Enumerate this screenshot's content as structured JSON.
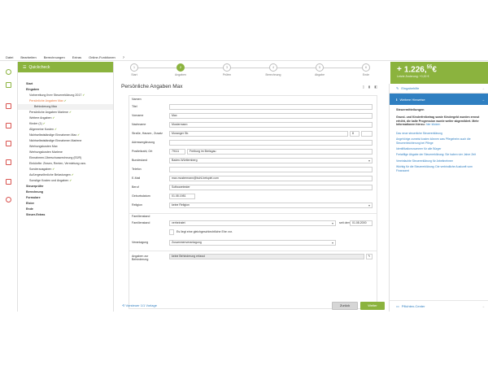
{
  "menu": [
    "Datei",
    "Bearbeiten",
    "Berechnungen",
    "Extras",
    "Online-Funktionen",
    "?"
  ],
  "steps": [
    {
      "num": "1",
      "label": "Start"
    },
    {
      "num": "2",
      "label": "Angaben"
    },
    {
      "num": "3",
      "label": "Prüfen"
    },
    {
      "num": "4",
      "label": "Berechnung"
    },
    {
      "num": "5",
      "label": "Abgabe"
    },
    {
      "num": "6",
      "label": "Ende"
    }
  ],
  "tax": {
    "amount": "1.226,",
    "cents": "55",
    "currency": "€",
    "sub": "Letzte Änderung: +0,00 €"
  },
  "sidebar": {
    "title": "Quickcheck",
    "items": [
      {
        "label": "Start",
        "level": "l1",
        "bold": true,
        "state": "",
        "check": ""
      },
      {
        "label": "Eingaben",
        "level": "l1",
        "bold": true,
        "state": "",
        "check": ""
      },
      {
        "label": "Vorbereitung Ihrer Steuererklärung 2017",
        "level": "l2",
        "bold": false,
        "state": "",
        "check": "✔"
      },
      {
        "label": "Persönliche Angaben Max",
        "level": "l2",
        "bold": false,
        "state": "sel",
        "check": "✔"
      },
      {
        "label": "Behinderung Max",
        "level": "l3",
        "bold": false,
        "state": "sel2",
        "check": ""
      },
      {
        "label": "Persönliche Angaben Marlene",
        "level": "l2",
        "bold": false,
        "state": "",
        "check": "✔"
      },
      {
        "label": "Weitere Angaben",
        "level": "l2",
        "bold": false,
        "state": "",
        "check": "✔"
      },
      {
        "label": "Kinder (1)",
        "level": "l2",
        "bold": false,
        "state": "",
        "check": "✔"
      },
      {
        "label": "Allgemeine Kosten",
        "level": "l2",
        "bold": false,
        "state": "",
        "check": "✔"
      },
      {
        "label": "Nichtselbstständige Einnahmen Max",
        "level": "l2",
        "bold": false,
        "state": "",
        "check": "✔"
      },
      {
        "label": "Nichtselbstständige Einnahmen Marlene",
        "level": "l2",
        "bold": false,
        "state": "",
        "check": ""
      },
      {
        "label": "Werbungskosten Max",
        "level": "l2",
        "bold": false,
        "state": "",
        "check": ""
      },
      {
        "label": "Werbungskosten Marlene",
        "level": "l2",
        "bold": false,
        "state": "",
        "check": ""
      },
      {
        "label": "Einnahmen-Überschussrechnung (EÜR)",
        "level": "l2",
        "bold": false,
        "state": "",
        "check": ""
      },
      {
        "label": "Einkünfte: Zinsen, Renten, Vermietung usw.",
        "level": "l2",
        "bold": false,
        "state": "",
        "check": ""
      },
      {
        "label": "Sonderausgaben",
        "level": "l2",
        "bold": false,
        "state": "",
        "check": "✔"
      },
      {
        "label": "Außergewöhnliche Belastungen",
        "level": "l2",
        "bold": false,
        "state": "",
        "check": "✔"
      },
      {
        "label": "Sonstige Kosten und Angaben",
        "level": "l2",
        "bold": false,
        "state": "",
        "check": "✔"
      },
      {
        "label": "Steuerprüfer",
        "level": "l1",
        "bold": true,
        "state": "",
        "check": ""
      },
      {
        "label": "Berechnung",
        "level": "l1",
        "bold": true,
        "state": "",
        "check": ""
      },
      {
        "label": "Formulare",
        "level": "l1",
        "bold": true,
        "state": "",
        "check": ""
      },
      {
        "label": "Elster",
        "level": "l1",
        "bold": true,
        "state": "",
        "check": ""
      },
      {
        "label": "Ende",
        "level": "l1",
        "bold": true,
        "state": "",
        "check": ""
      },
      {
        "label": "Steuer-Extras",
        "level": "l1",
        "bold": true,
        "state": "",
        "check": ""
      }
    ]
  },
  "main": {
    "title": "Persönliche Angaben Max",
    "tools": "▯ ▮ ◧",
    "section_names": "Namen",
    "fields": {
      "titel": {
        "label": "Titel",
        "value": ""
      },
      "vorname": {
        "label": "Vorname",
        "value": "Max"
      },
      "nachname": {
        "label": "Nachname",
        "value": "Mustermann"
      },
      "strasse": {
        "label": "Straße, Hausnr., Zusatz",
        "value": "Muranger Str.",
        "nr": "8"
      },
      "adresszusatz": {
        "label": "Adressergänzung",
        "value": ""
      },
      "plz": {
        "label": "Postleitzahl, Ort",
        "value": "79111",
        "ort": "Freiburg im Breisgau"
      },
      "bundesland": {
        "label": "Bundesland",
        "value": "Baden-Württemberg"
      },
      "telefon": {
        "label": "Telefon",
        "value": ""
      },
      "email": {
        "label": "E-Mail",
        "value": "max.mustermann@buhl-beispiel.com"
      },
      "beruf": {
        "label": "Beruf",
        "value": "Softwaretester"
      },
      "geburt": {
        "label": "Geburtsdatum",
        "value": "01.08.1981"
      },
      "religion": {
        "label": "Religion",
        "value": "keine Religion"
      }
    },
    "section_family": "Familienstand",
    "familienstand": {
      "label": "Familienstand",
      "value": "verheiratet",
      "since_label": "seit dem",
      "since": "01.08.2000"
    },
    "partnerschaft": "Es liegt eine gleichgeschlechtliche Ehe vor.",
    "veranlagung": {
      "label": "Veranlagung",
      "value": "Zusammenveranlagung"
    },
    "behinderung": {
      "label": "Angaben zur Behinderung",
      "value": "keine Behinderung erfasst"
    }
  },
  "footer": {
    "restore": "Vorsteuer 1/1 Vorlage",
    "back": "Zurück",
    "next": "Weiter"
  },
  "right": {
    "eingabehilfe": "Eingabehilfe",
    "hinweise": "Weitere Hinweise",
    "section": "Steuermitteilungen",
    "text": "Grund- und Kinderfreibetrag sowie Kindergeld wurden erneut erhöht, die kalte Progression wurde weiter abgemildert. Mehr Informationen hierzu:",
    "more": "hier klicken",
    "links": [
      "Das neue steuerliche Steuererklärung",
      "Angehörige zumeist kosten können was Pflegeheim auch die Steuererleichterung bei Pflege",
      "Identifikationsnummer für alle Bürger",
      "Freiwillige Abgabe der Steuererklärung: Sie haben vier Jahre Zeit",
      "Vereinfachte Steuererklärung für Arbeitnehmer",
      "Wichtig für die Steuererklärung: Die verbindliche Auskunft vom Finanzamt"
    ],
    "center": "Pflichten-Center"
  }
}
